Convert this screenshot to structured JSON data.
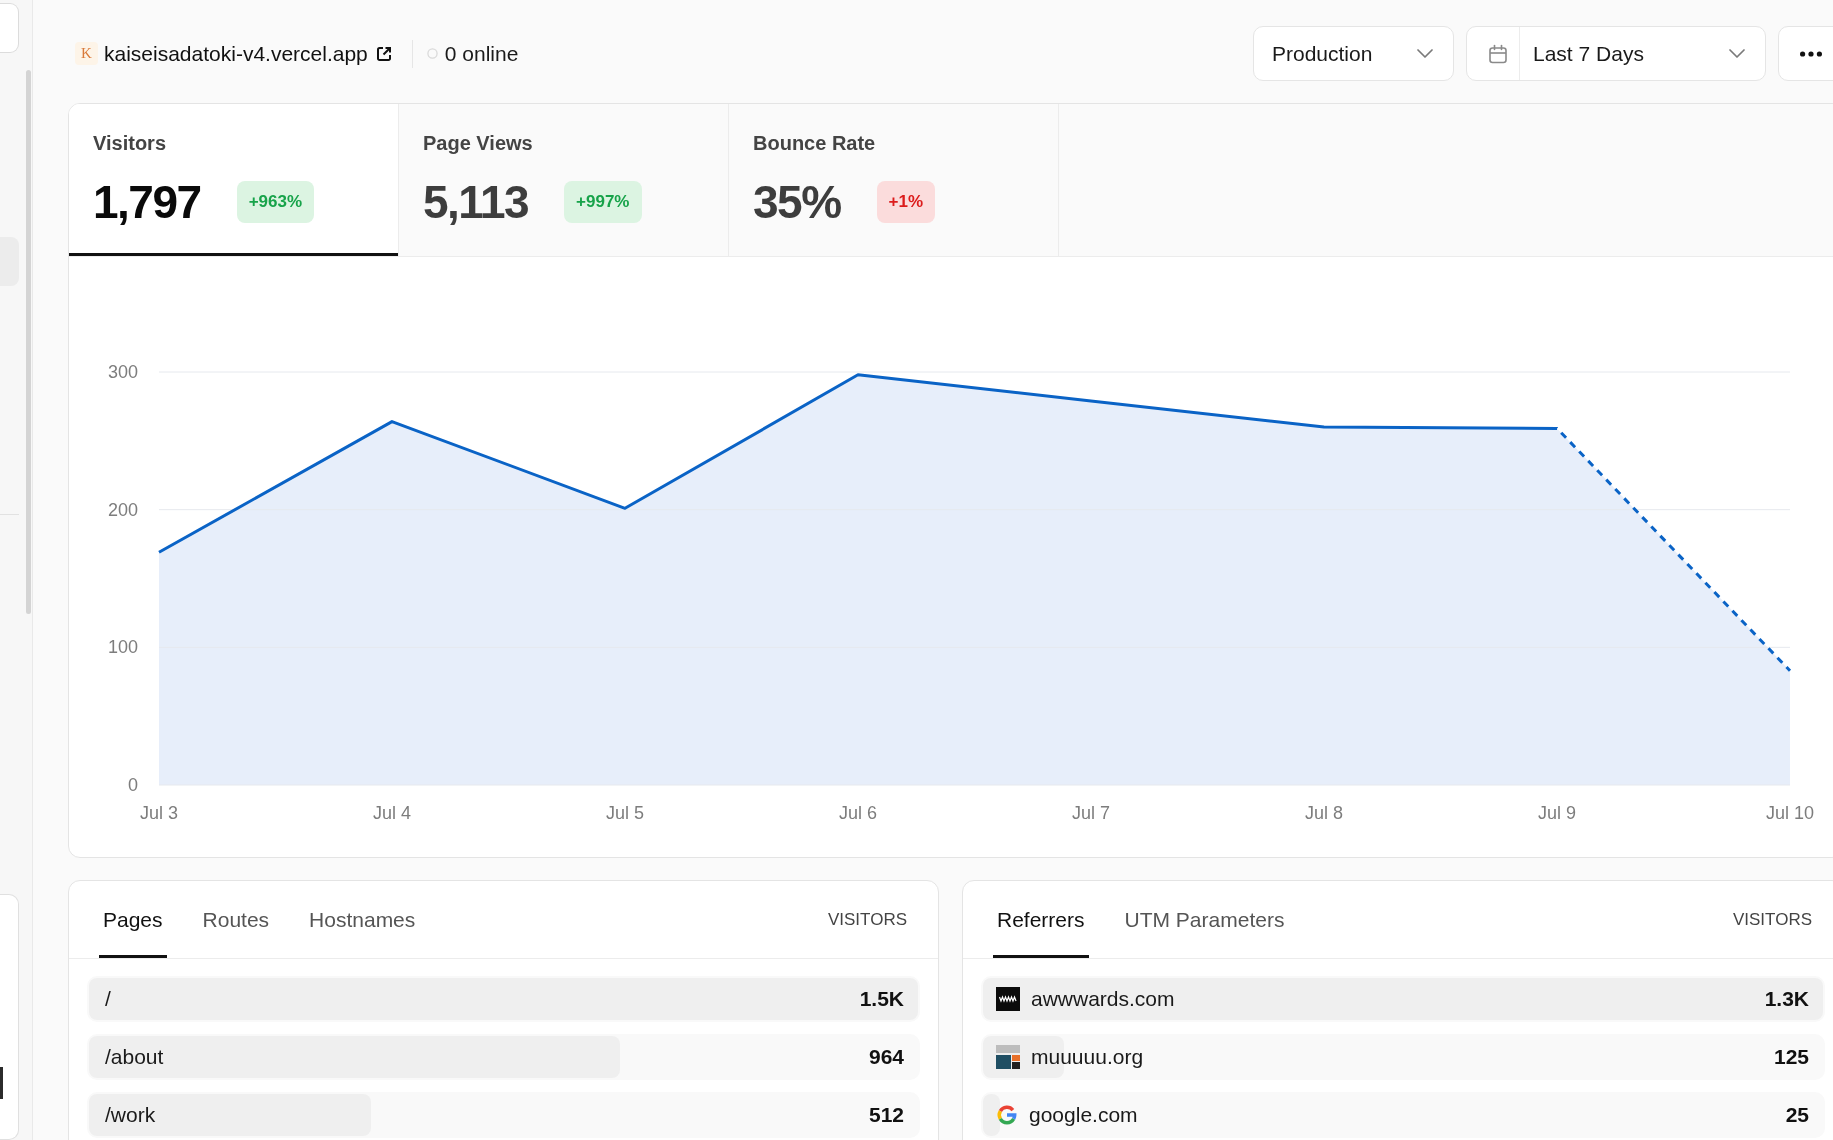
{
  "header": {
    "site": {
      "favicon": "K",
      "domain": "kaiseisadatoki-v4.vercel.app"
    },
    "presence": {
      "live": false,
      "label": "0 online"
    },
    "environment": "Production",
    "date_range": "Last 7 Days"
  },
  "metrics": [
    {
      "label": "Visitors",
      "value": "1,797",
      "change": "+963%",
      "kind": "positive",
      "selected": true
    },
    {
      "label": "Page Views",
      "value": "5,113",
      "change": "+997%",
      "kind": "positive",
      "selected": false
    },
    {
      "label": "Bounce Rate",
      "value": "35%",
      "change": "+1%",
      "kind": "negative",
      "selected": false
    }
  ],
  "chart": {
    "last_segment_partial": true,
    "chart_data": {
      "type": "area",
      "categories": [
        "Jul 3",
        "Jul 4",
        "Jul 5",
        "Jul 6",
        "Jul 7",
        "Jul 8",
        "Jul 9",
        "Jul 10"
      ],
      "values": [
        169,
        264,
        201,
        298,
        279,
        260,
        259,
        83
      ],
      "ylim": [
        0,
        300
      ],
      "yticks": [
        0,
        100,
        200,
        300
      ]
    }
  },
  "panels": [
    {
      "kind": "pages",
      "tabs": [
        {
          "label": "Pages",
          "selected": true
        },
        {
          "label": "Routes",
          "selected": false
        },
        {
          "label": "Hostnames",
          "selected": false
        }
      ],
      "column_label": "VISITORS",
      "rows": [
        {
          "label": "/",
          "value": "1.5K",
          "level": 1
        },
        {
          "label": "/about",
          "value": "964",
          "level": 0.64
        },
        {
          "label": "/work",
          "value": "512",
          "level": 0.34
        }
      ]
    },
    {
      "kind": "referrers",
      "tabs": [
        {
          "label": "Referrers",
          "selected": true
        },
        {
          "label": "UTM Parameters",
          "selected": false
        }
      ],
      "column_label": "VISITORS",
      "rows": [
        {
          "label": "awwwards.com",
          "value": "1.3K",
          "level": 1
        },
        {
          "label": "muuuuu.org",
          "value": "125",
          "level": 0.096
        },
        {
          "label": "google.com",
          "value": "25",
          "level": 0.02
        }
      ]
    }
  ]
}
